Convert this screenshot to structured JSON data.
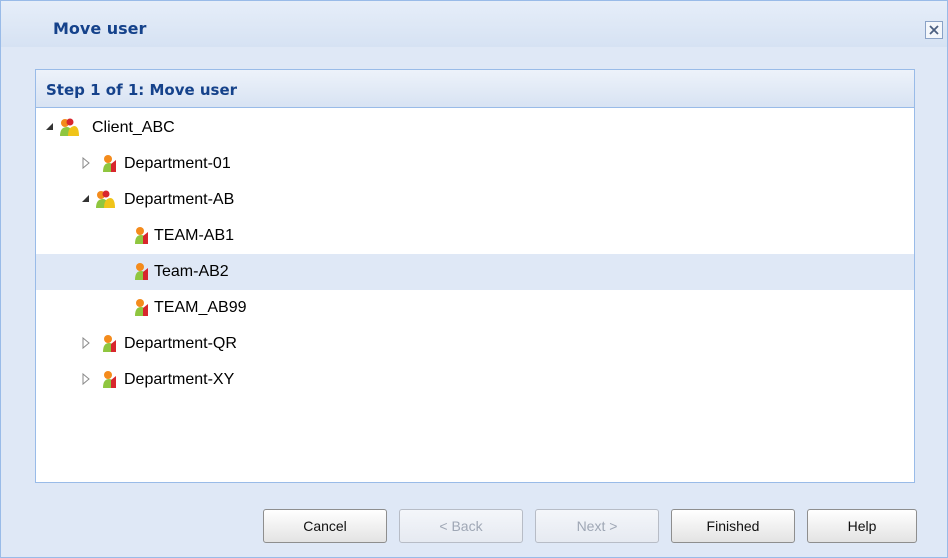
{
  "dialog": {
    "title": "Move user"
  },
  "step": {
    "title": "Step 1 of 1: Move user"
  },
  "tree": [
    {
      "label": "Client_ABC",
      "expanded": true,
      "icon": "group-icon",
      "selected": false
    },
    {
      "label": "Department-01",
      "expanded": false,
      "icon": "user-icon",
      "selected": false
    },
    {
      "label": "Department-AB",
      "expanded": true,
      "icon": "group-icon",
      "selected": false
    },
    {
      "label": "TEAM-AB1",
      "expanded": null,
      "icon": "user-icon",
      "selected": false
    },
    {
      "label": "Team-AB2",
      "expanded": null,
      "icon": "user-icon",
      "selected": true
    },
    {
      "label": "TEAM_AB99",
      "expanded": null,
      "icon": "user-icon",
      "selected": false
    },
    {
      "label": "Department-QR",
      "expanded": false,
      "icon": "user-icon",
      "selected": false
    },
    {
      "label": "Department-XY",
      "expanded": false,
      "icon": "user-icon",
      "selected": false
    }
  ],
  "buttons": {
    "cancel": "Cancel",
    "back": "< Back",
    "next": "Next >",
    "finished": "Finished",
    "help": "Help"
  },
  "colors": {
    "title_text": "#15428b",
    "dialog_bg": "#dfe8f6",
    "border": "#99bbe8",
    "selected_row": "#dfe8f6"
  }
}
